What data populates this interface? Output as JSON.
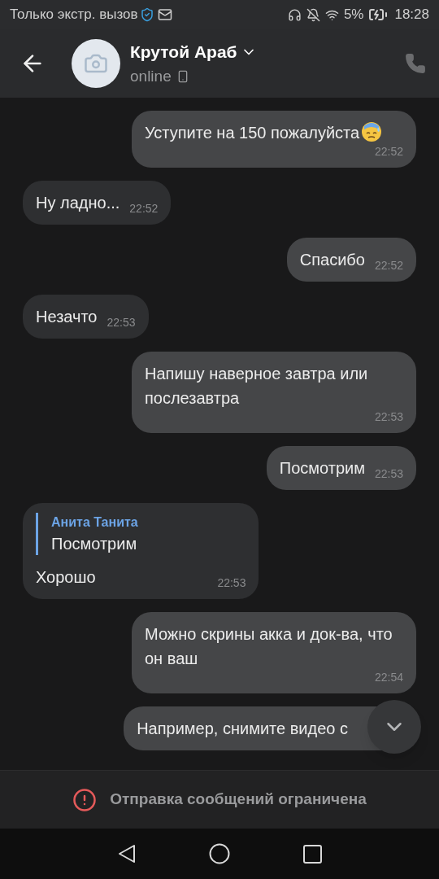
{
  "status_bar": {
    "carrier": "Только экстр. вызов",
    "battery": "5%",
    "time": "18:28"
  },
  "header": {
    "name": "Крутой Араб",
    "status": "online"
  },
  "messages": [
    {
      "outgoing": true,
      "text": "Уступите на 150 пожалуйста",
      "emoji": true,
      "time": "22:52"
    },
    {
      "outgoing": false,
      "text": "Ну ладно...",
      "time": "22:52"
    },
    {
      "outgoing": true,
      "text": "Спасибо",
      "time": "22:52"
    },
    {
      "outgoing": false,
      "text": "Незачто",
      "time": "22:53"
    },
    {
      "outgoing": true,
      "text": "Напишу наверное завтра или послезавтра",
      "time": "22:53"
    },
    {
      "outgoing": true,
      "text": "Посмотрим",
      "time": "22:53"
    },
    {
      "outgoing": false,
      "reply": {
        "author": "Анита Танита",
        "text": "Посмотрим"
      },
      "text": "Хорошо",
      "time": "22:53"
    },
    {
      "outgoing": true,
      "text": "Можно скрины акка и док-ва, что он ваш",
      "time": "22:54"
    },
    {
      "outgoing": true,
      "text": "Например, снимите видео с"
    }
  ],
  "footer": {
    "notice": "Отправка сообщений ограничена"
  }
}
